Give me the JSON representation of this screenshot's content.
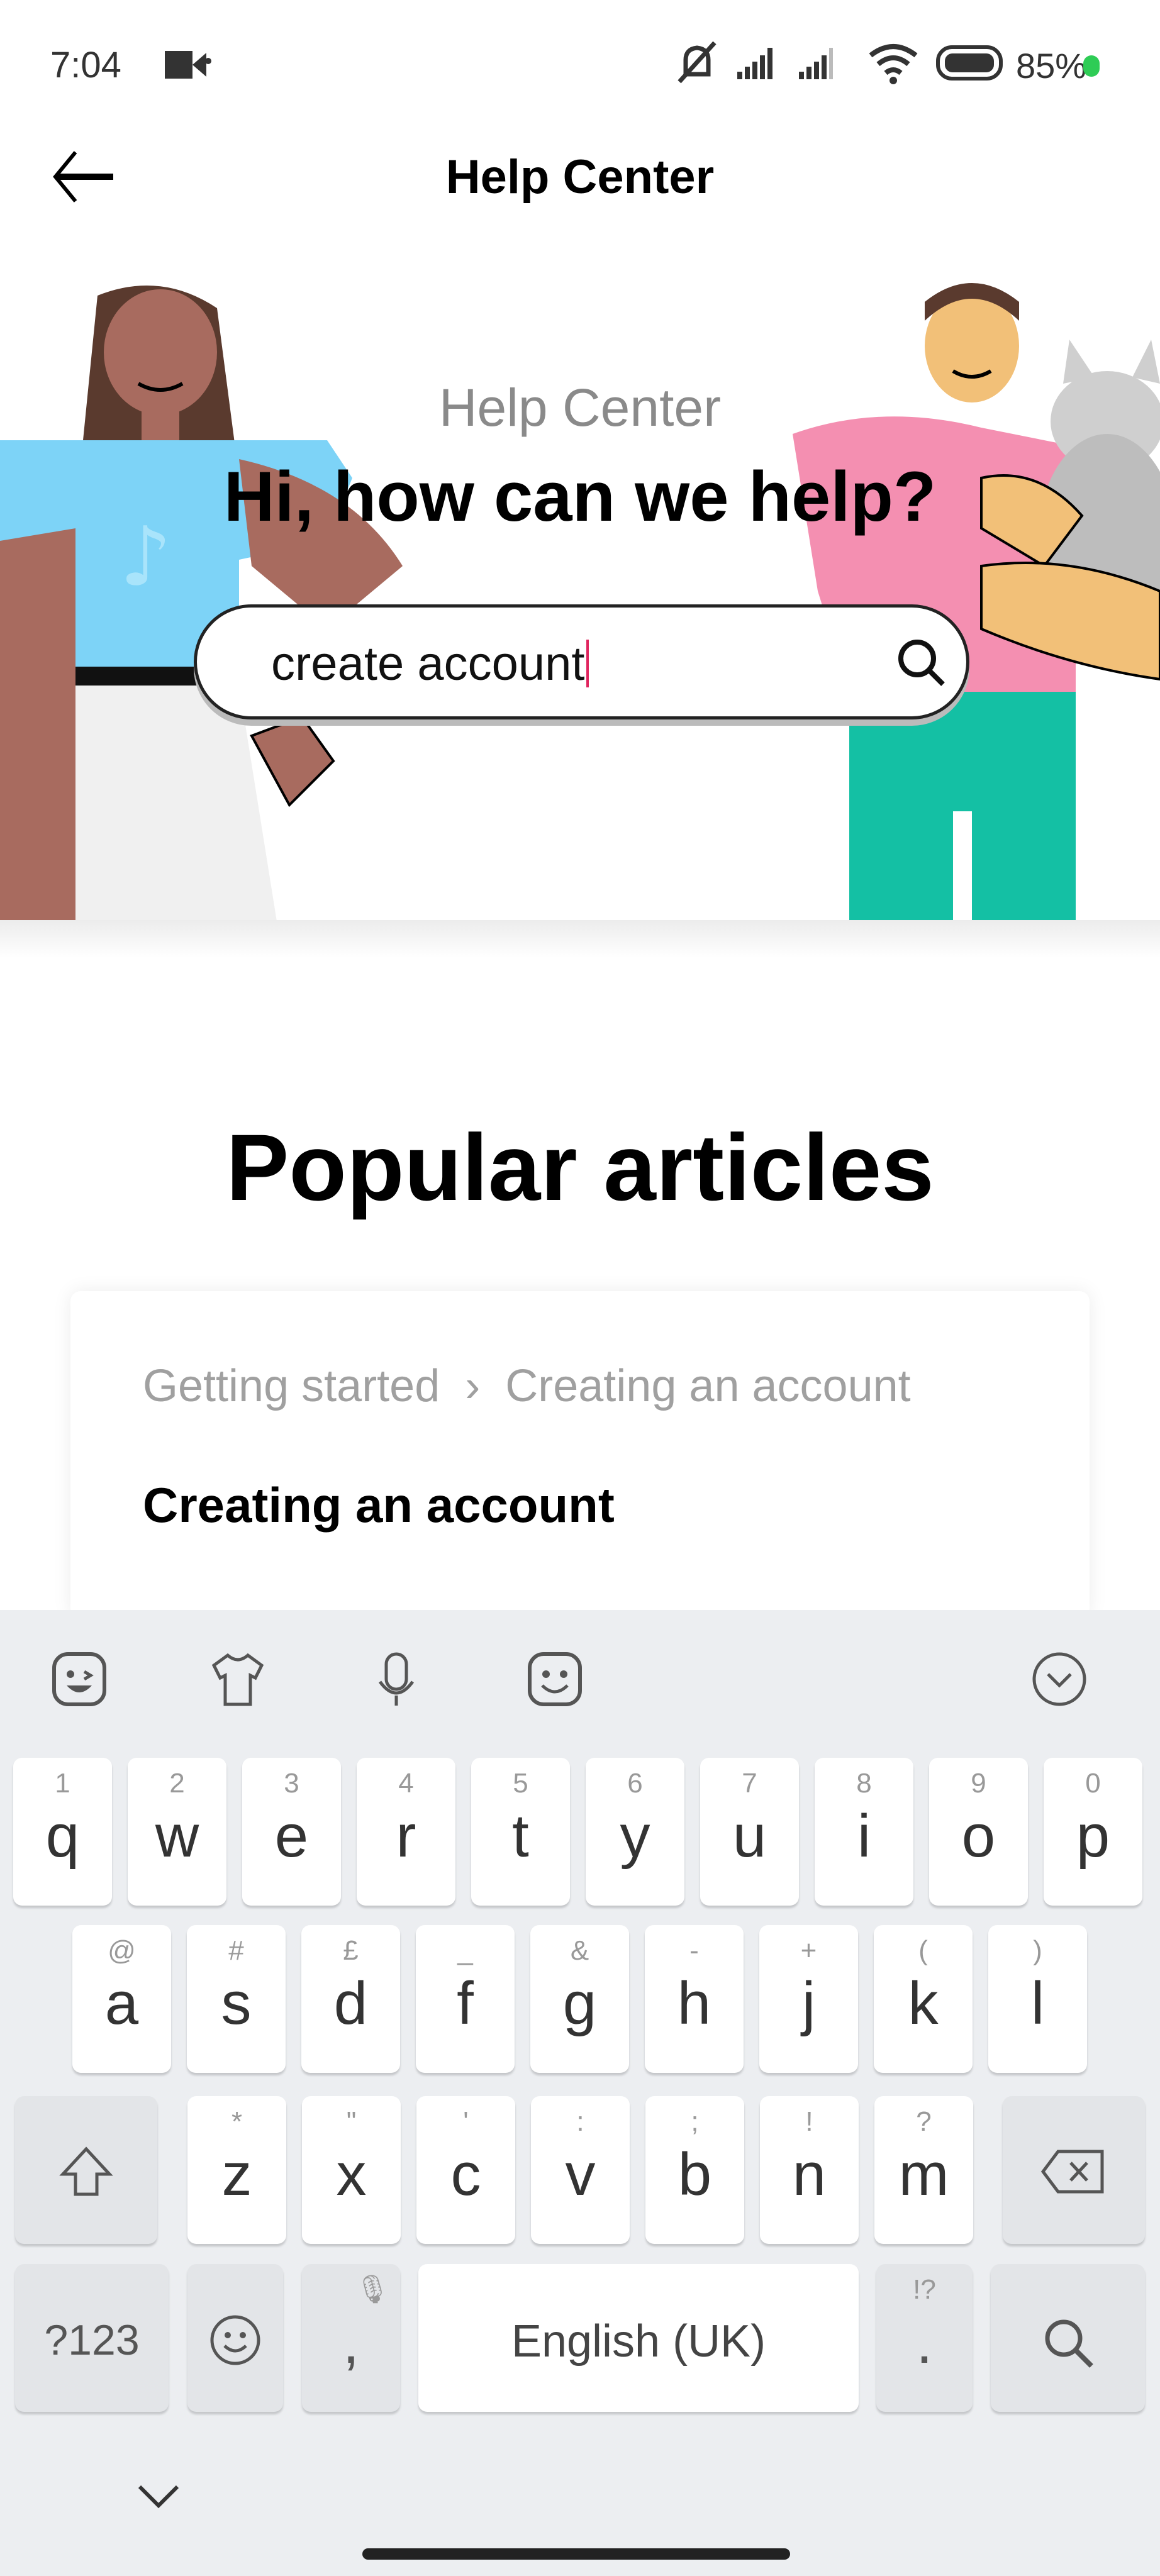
{
  "status_bar": {
    "time": "7:04",
    "battery": "85%",
    "icons": [
      "video-camera-icon",
      "dot-icon",
      "mute-icon",
      "signal-icon",
      "signal-icon",
      "wifi-icon",
      "battery-icon"
    ],
    "battery_dot_color": "#2ecc55"
  },
  "header": {
    "title": "Help Center",
    "back_icon": "arrow-left-icon"
  },
  "hero": {
    "subtitle": "Help Center",
    "title": "Hi, how can we help?",
    "search": {
      "value": "create account",
      "icon": "search-icon"
    }
  },
  "popular": {
    "title": "Popular articles",
    "articles": [
      {
        "breadcrumb": [
          "Getting started",
          "Creating an account"
        ],
        "title": "Creating an account"
      }
    ]
  },
  "keyboard": {
    "toolbar": [
      "sticker-icon",
      "theme-shirt-icon",
      "microphone-icon",
      "emoji-icon",
      "collapse-keyboard-icon"
    ],
    "row1": [
      [
        "q",
        "1"
      ],
      [
        "w",
        "2"
      ],
      [
        "e",
        "3"
      ],
      [
        "r",
        "4"
      ],
      [
        "t",
        "5"
      ],
      [
        "y",
        "6"
      ],
      [
        "u",
        "7"
      ],
      [
        "i",
        "8"
      ],
      [
        "o",
        "9"
      ],
      [
        "p",
        "0"
      ]
    ],
    "row2": [
      [
        "a",
        "@"
      ],
      [
        "s",
        "#"
      ],
      [
        "d",
        "£"
      ],
      [
        "f",
        "_"
      ],
      [
        "g",
        "&"
      ],
      [
        "h",
        "-"
      ],
      [
        "j",
        "+"
      ],
      [
        "k",
        "("
      ],
      [
        "l",
        ")"
      ]
    ],
    "row3": [
      [
        "z",
        "*"
      ],
      [
        "x",
        "\""
      ],
      [
        "c",
        "'"
      ],
      [
        "v",
        ":"
      ],
      [
        "b",
        ";"
      ],
      [
        "n",
        "!"
      ],
      [
        "m",
        "?"
      ]
    ],
    "symbols_label": "?123",
    "comma": ",",
    "space_label": "English (UK)",
    "period": ".",
    "period_hint": "!?"
  },
  "colors": {
    "accent_caret": "#e0245e",
    "shirt_blue": "#7dd3f7",
    "shirt_pink": "#f48fb1",
    "pants_teal": "#14c0a4"
  }
}
